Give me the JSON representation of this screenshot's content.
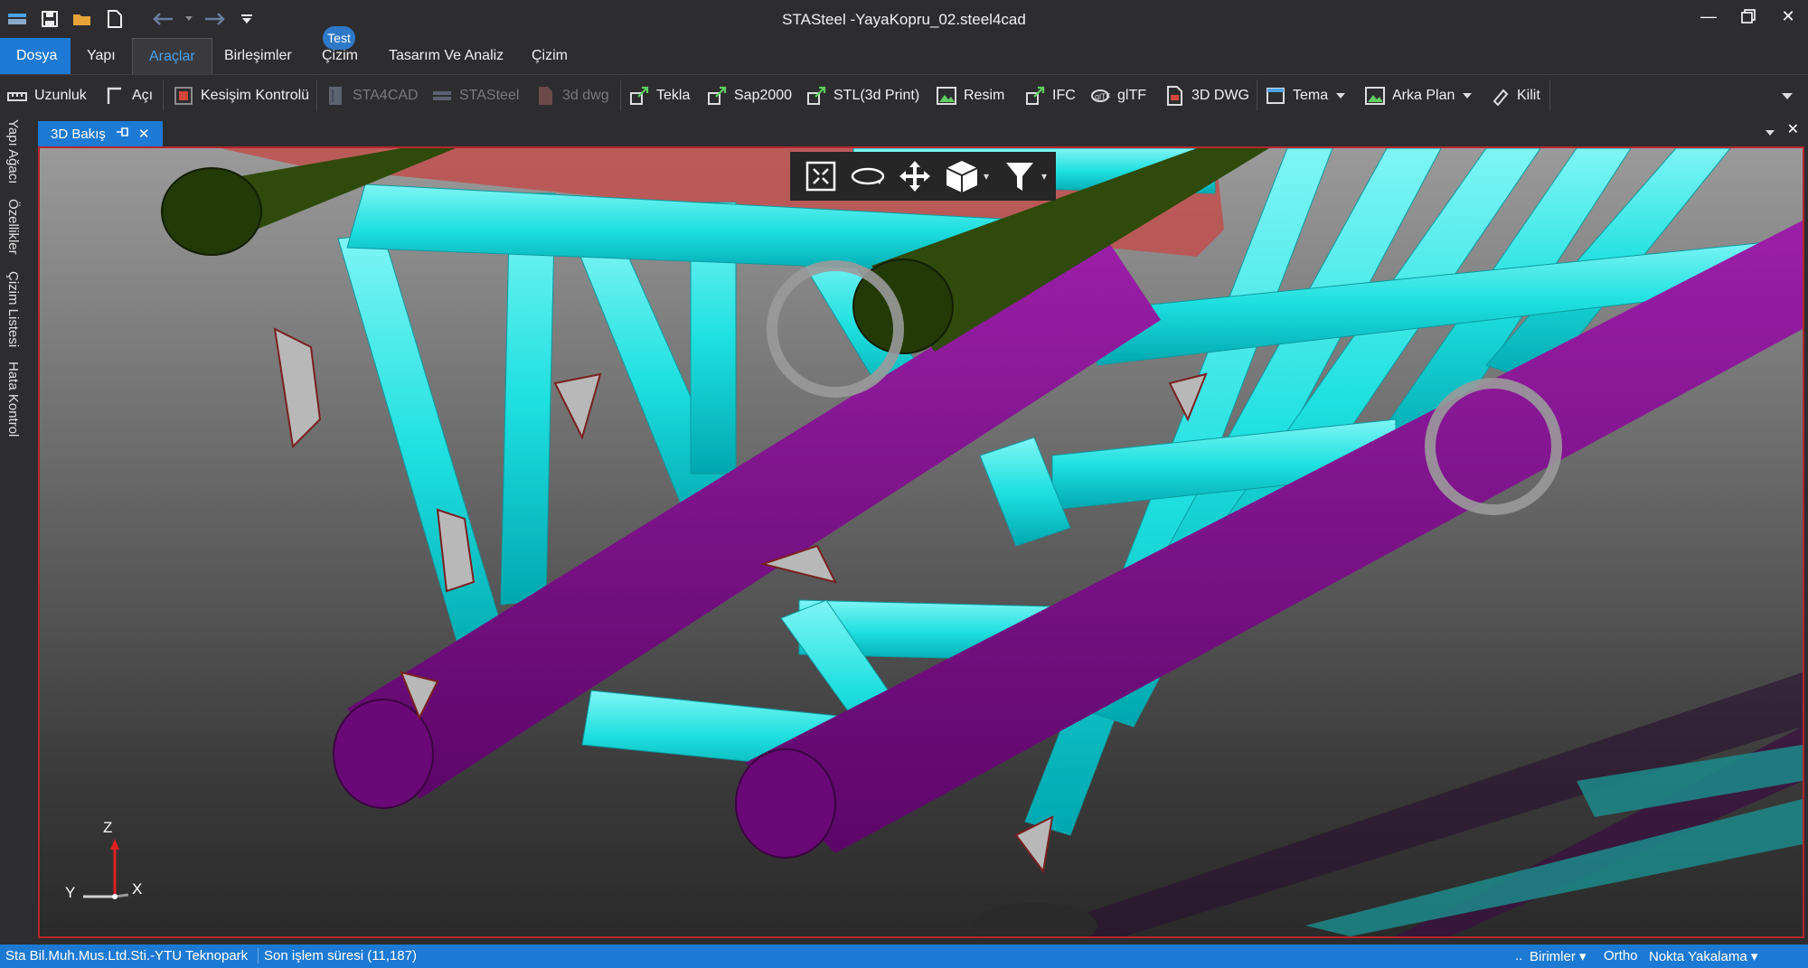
{
  "window": {
    "title": "STASteel -YayaKopru_02.steel4cad"
  },
  "quick_access": {
    "icons": [
      "app-menu-icon",
      "save-icon",
      "open-folder-icon",
      "new-document-icon",
      "undo-icon",
      "undo-dropdown-icon",
      "redo-icon",
      "customize-dropdown-icon"
    ]
  },
  "menu": {
    "file": "Dosya",
    "items": [
      "Yapı",
      "Araçlar",
      "Birleşimler",
      "Çizim",
      "Tasarım Ve Analiz",
      "Çizim"
    ],
    "active_index": 1,
    "badge": "Test"
  },
  "toolbar": {
    "uzunluk": "Uzunluk",
    "aci": "Açı",
    "kesisim": "Kesişim Kontrolü",
    "sta4cad": "STA4CAD",
    "stasteel": "STASteel",
    "dwg3d_small": "3d dwg",
    "tekla": "Tekla",
    "sap2000": "Sap2000",
    "stl": "STL(3d Print)",
    "resim": "Resim",
    "ifc": "IFC",
    "gltf": "glTF",
    "dwg3d": "3D DWG",
    "tema": "Tema",
    "arka_plan": "Arka Plan",
    "kilit": "Kilit"
  },
  "side_tabs": [
    "Yapı Ağacı",
    "Özellikler",
    "Çizim Listesi",
    "Hata Kontrol"
  ],
  "document_tab": {
    "label": "3D Bakış"
  },
  "axes": {
    "z": "Z",
    "y": "Y",
    "x": "X"
  },
  "colors": {
    "accent": "#1c7ad4",
    "member": "#00e5e5",
    "chord": "#7a0a86",
    "beam_red": "#c0504d",
    "dark_green": "#2f4a0a"
  },
  "status": {
    "company": "Sta Bil.Muh.Mus.Ltd.Sti.-YTU Teknopark",
    "last_op": "Son işlem süresi (11,187)",
    "units": "Birimler",
    "ortho": "Ortho",
    "snap": "Nokta Yakalama"
  }
}
